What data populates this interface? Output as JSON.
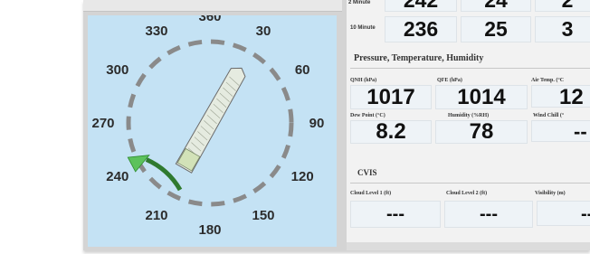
{
  "wind_table": {
    "rows": [
      {
        "label": "2 Minute",
        "values": [
          "242",
          "24",
          "2"
        ]
      },
      {
        "label": "10 Minute",
        "values": [
          "236",
          "25",
          "3"
        ]
      }
    ]
  },
  "pth": {
    "title": "Pressure, Temperature, Humidity",
    "fields": [
      {
        "label": "QNH (hPa)",
        "value": "1017"
      },
      {
        "label": "QFE (hPa)",
        "value": "1014"
      },
      {
        "label": "Air Temp. (°C",
        "value": "12"
      },
      {
        "label": "Dew Point (°C)",
        "value": "8.2"
      },
      {
        "label": "Humidity (%RH)",
        "value": "78"
      },
      {
        "label": "Wind Chill (°",
        "value": "--"
      }
    ]
  },
  "cvis": {
    "title": "CVIS",
    "fields": [
      {
        "label": "Cloud Level 1 (ft)",
        "value": "---"
      },
      {
        "label": "Cloud Level 2 (ft)",
        "value": "---"
      },
      {
        "label": "Visibility (m)",
        "value": "--"
      }
    ]
  },
  "compass": {
    "bearings": [
      "360",
      "30",
      "60",
      "90",
      "120",
      "150",
      "180",
      "210",
      "240",
      "270",
      "300",
      "330"
    ],
    "wind_direction_deg": 242,
    "vessel_heading_deg": 30,
    "colors": {
      "background": "#c4e2f4",
      "ring_dash": "#8a8a8a",
      "wind_arc": "#2f7a2f",
      "wind_arrow": "#5cc25c",
      "vessel_fill": "#e5ebe0"
    }
  }
}
